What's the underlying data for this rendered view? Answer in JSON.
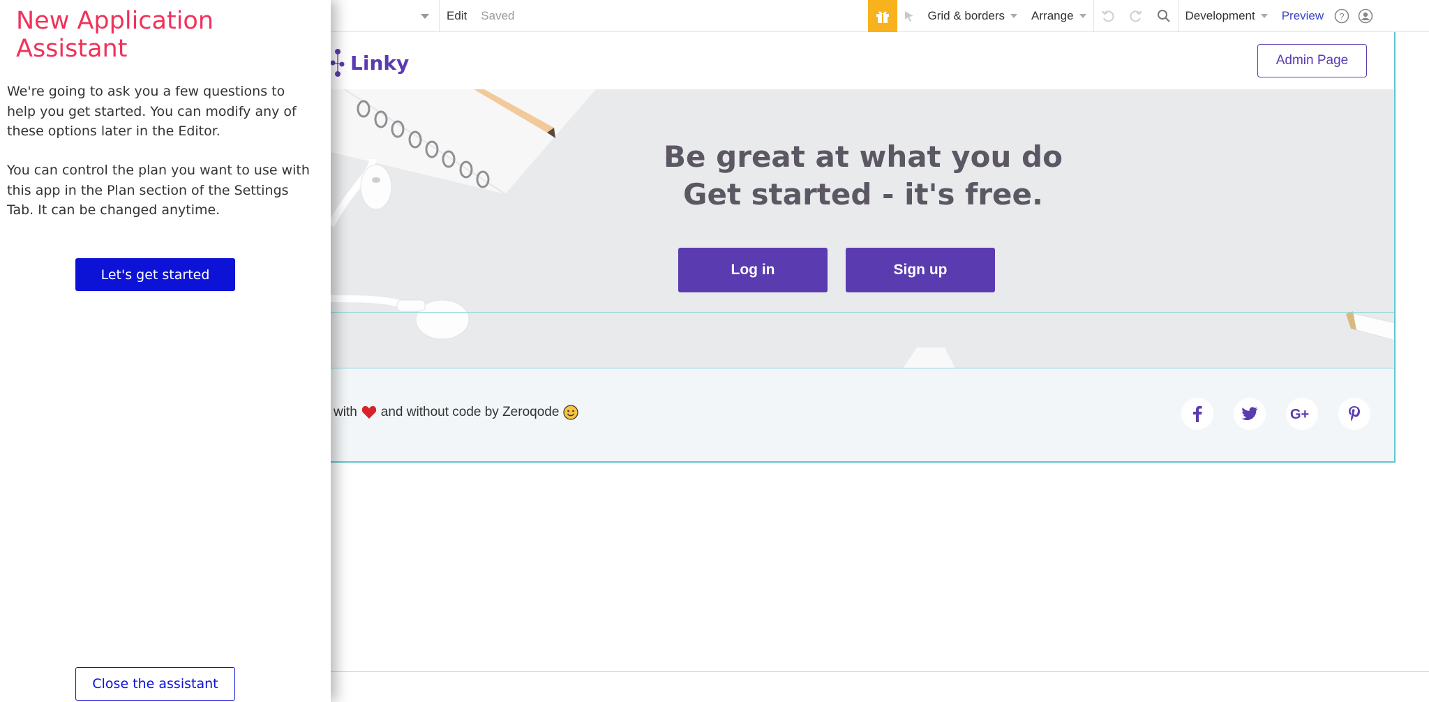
{
  "assistant": {
    "title": "New Application Assistant",
    "paragraph1": "We're going to ask you a few questions to help you get started. You can modify any of these options later in the Editor.",
    "paragraph2": "You can control the plan you want to use with this app in the Plan section of the Settings Tab. It can be changed anytime.",
    "start_button": "Let's get started",
    "close_button": "Close the assistant",
    "title_color": "#f0325a",
    "accent_color": "#0c12d6"
  },
  "toolbar": {
    "edit_label": "Edit",
    "saved_label": "Saved",
    "grid_label": "Grid & borders",
    "arrange_label": "Arrange",
    "environment_label": "Development",
    "preview_label": "Preview",
    "gift_color": "#f7b21d"
  },
  "page": {
    "logo_text": "Linky",
    "admin_button": "Admin Page",
    "hero_line1": "Be great at what you do",
    "hero_line2": "Get started - it's free.",
    "login_button": "Log in",
    "signup_button": "Sign up",
    "footer_with": "with",
    "footer_rest": "and without code by Zeroqode",
    "brand_color": "#5b3bb0",
    "social": [
      "facebook-icon",
      "twitter-icon",
      "google-plus-icon",
      "pinterest-icon"
    ]
  }
}
